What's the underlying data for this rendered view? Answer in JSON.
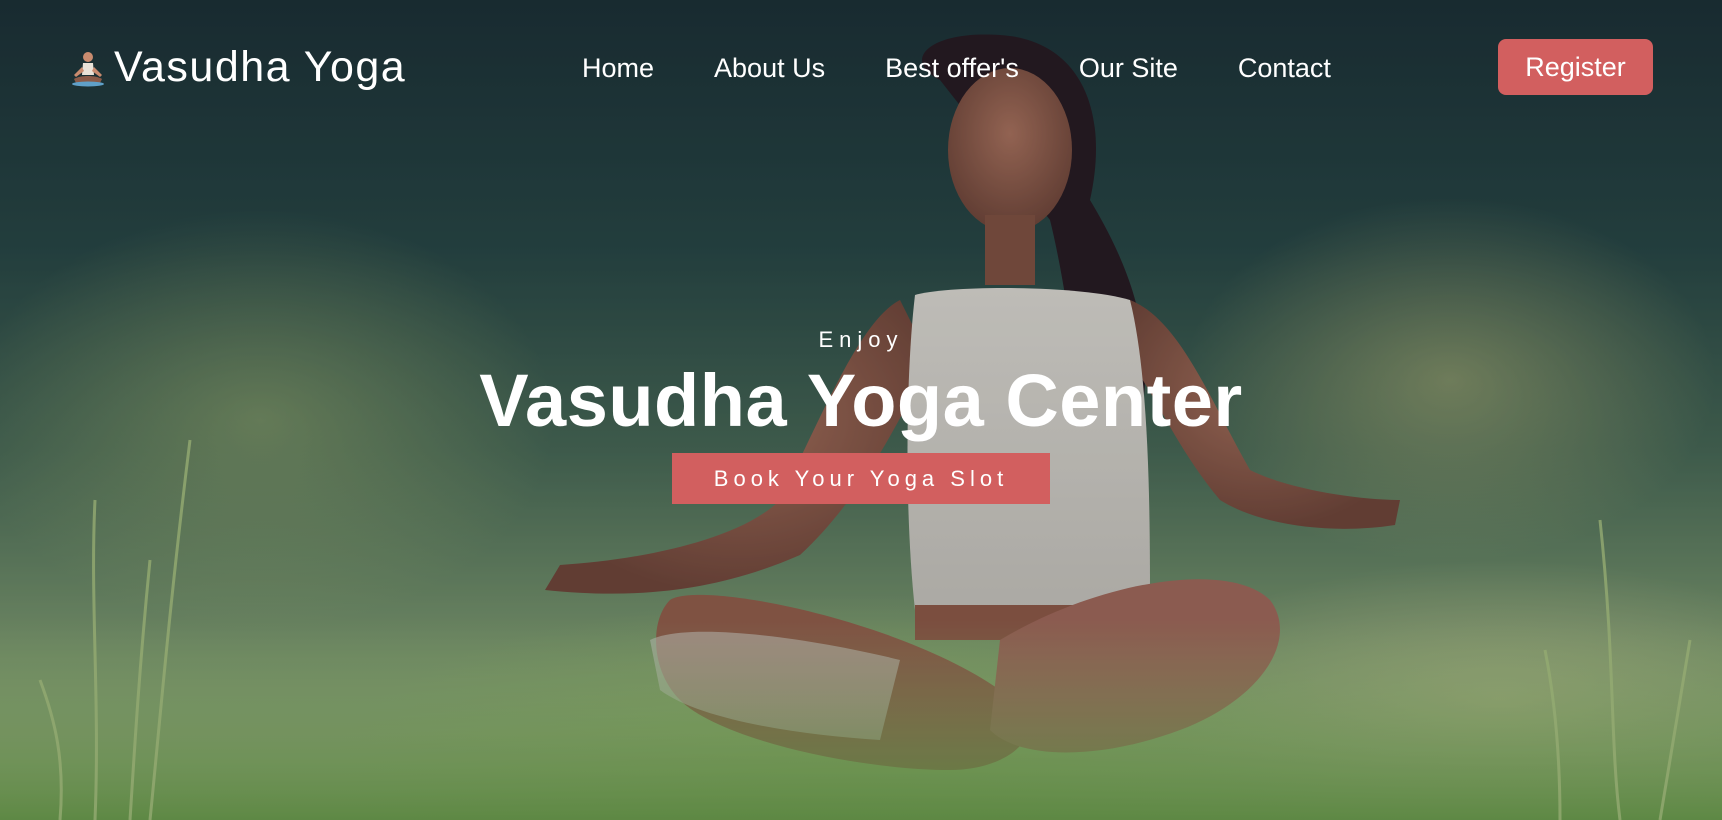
{
  "brand": {
    "name": "Vasudha Yoga",
    "icon": "meditating-person-icon"
  },
  "nav": {
    "items": [
      {
        "label": "Home"
      },
      {
        "label": "About Us"
      },
      {
        "label": "Best offer's"
      },
      {
        "label": "Our Site"
      },
      {
        "label": "Contact"
      }
    ],
    "register_label": "Register"
  },
  "hero": {
    "eyebrow": "Enjoy",
    "title": "Vasudha Yoga Center",
    "cta_label": "Book Your Yoga Slot",
    "background": "woman-meditating-in-grass-photo"
  },
  "colors": {
    "accent": "#d25f5f",
    "text": "#ffffff"
  }
}
